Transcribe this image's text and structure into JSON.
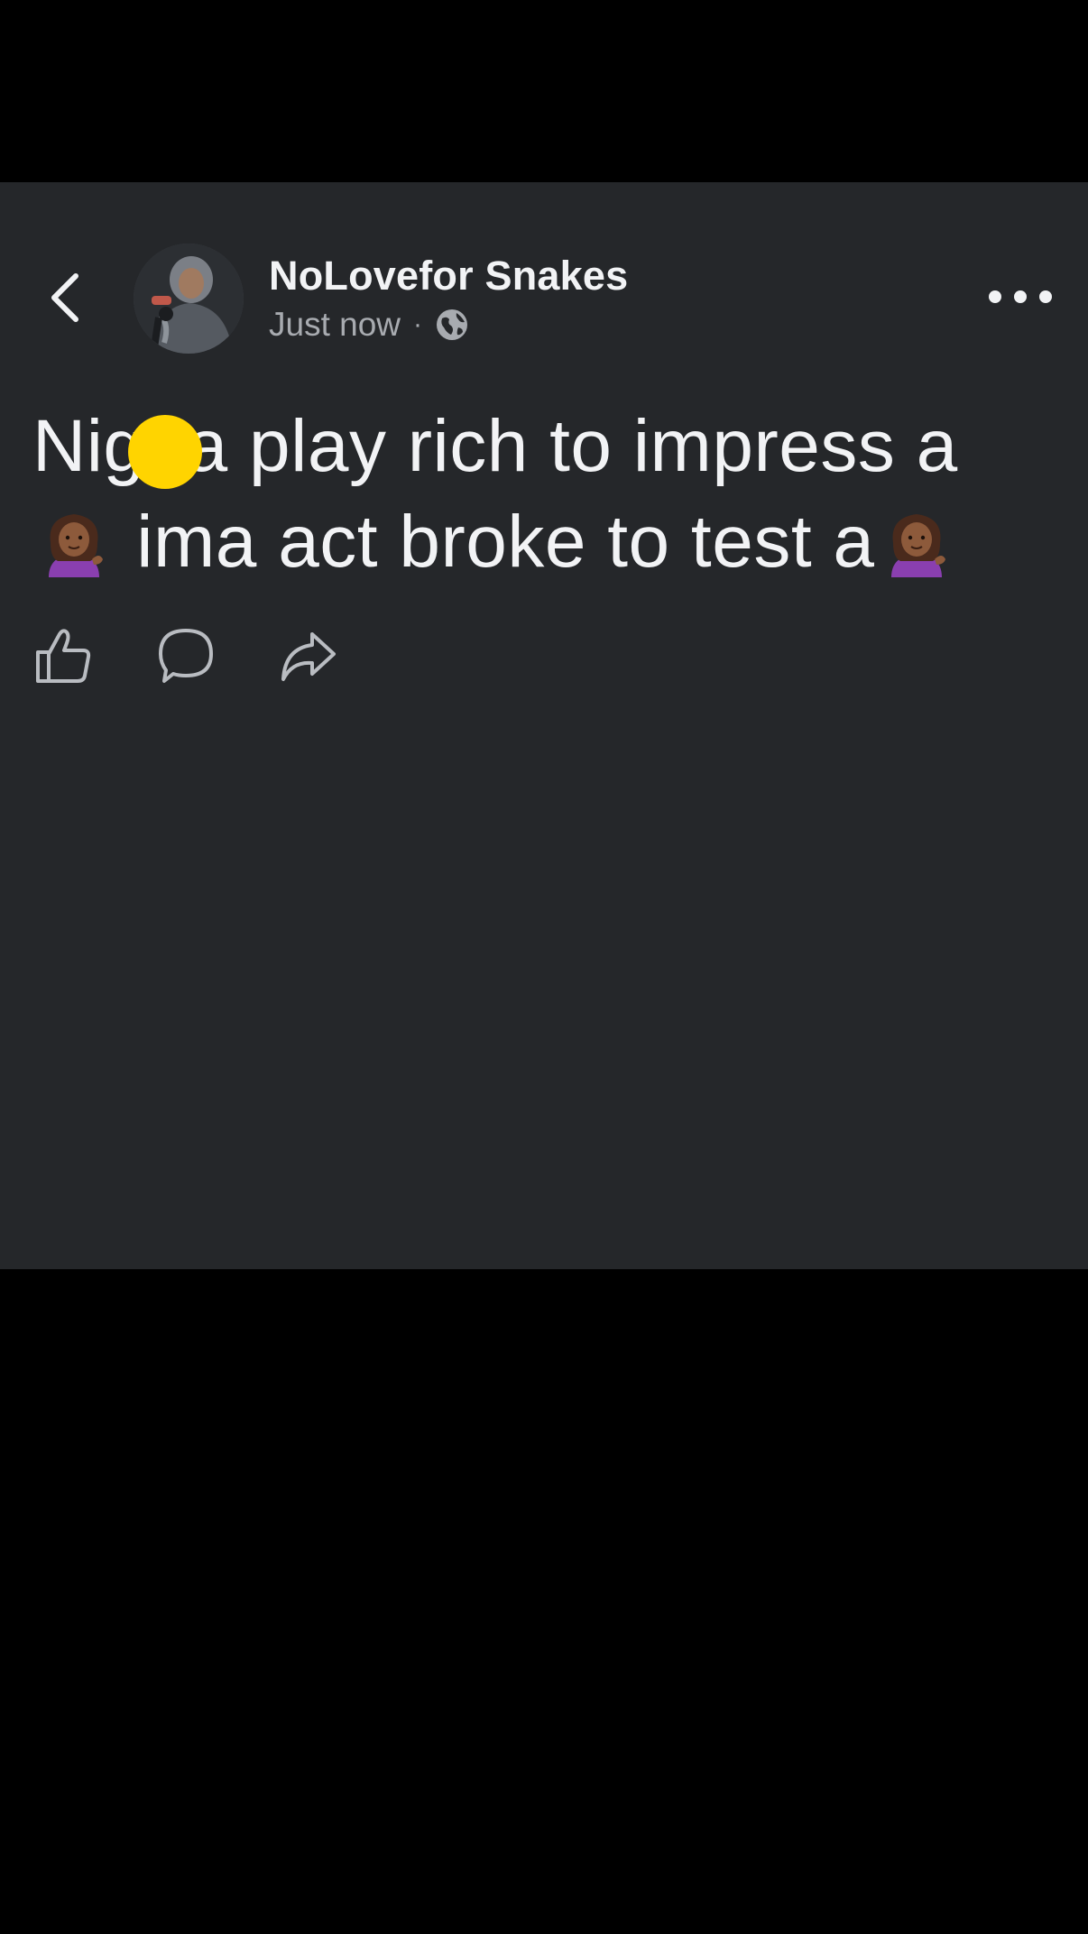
{
  "post": {
    "author_name": "NoLovefor Snakes",
    "timestamp": "Just now",
    "separator": "·",
    "privacy_icon": "globe-icon",
    "text_line1": "Nigga play rich to impress a",
    "text_line2_middle": " ima act broke to test a",
    "emoji": "woman-tipping-hand-emoji"
  },
  "header": {
    "back_icon": "chevron-left-icon",
    "more_icon": "more-horizontal-icon"
  },
  "actions": [
    {
      "icon": "like-icon"
    },
    {
      "icon": "comment-icon"
    },
    {
      "icon": "share-icon"
    }
  ],
  "colors": {
    "page_background": "#000000",
    "card_background": "#25272a",
    "primary_text": "#f2f3f5",
    "secondary_text": "#a8abb0",
    "touch_indicator": "#ffd400"
  }
}
